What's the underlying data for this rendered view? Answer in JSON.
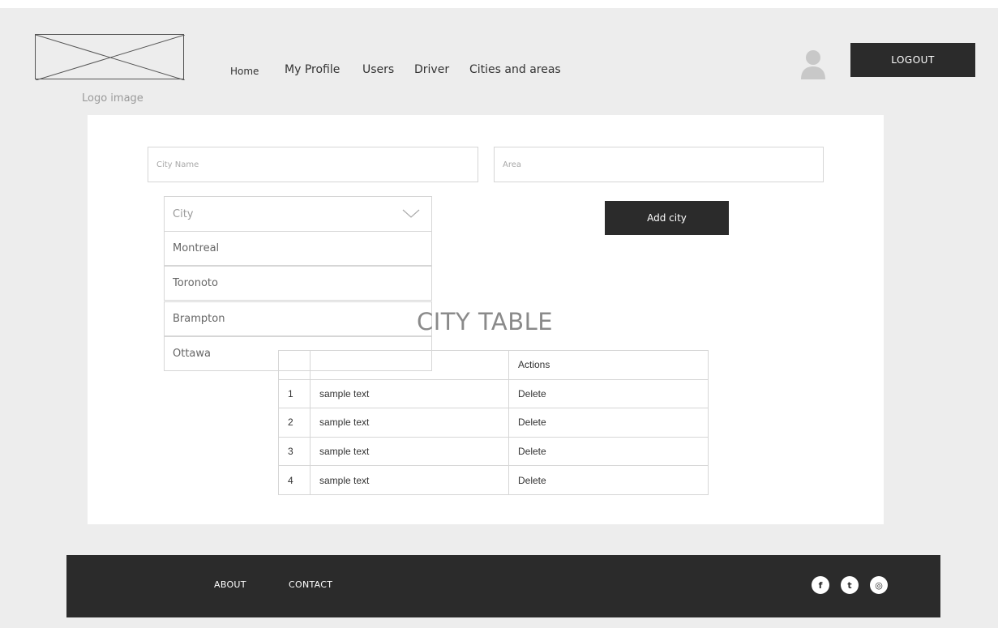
{
  "header": {
    "logo_caption": "Logo image",
    "nav": {
      "home": "Home",
      "my_profile": "My Profile",
      "users": "Users",
      "driver": "Driver",
      "cities_and_areas": "Cities and areas"
    },
    "logout_label": "LOGOUT"
  },
  "form": {
    "city_name_placeholder": "City Name",
    "area_placeholder": "Area",
    "city_dropdown": {
      "label": "City",
      "options": [
        "Montreal",
        "Toronoto",
        "Brampton",
        "Ottawa"
      ]
    },
    "add_city_label": "Add city"
  },
  "table": {
    "title": "CITY TABLE",
    "header": [
      "",
      "",
      "Actions"
    ],
    "rows": [
      {
        "index": "1",
        "text": "sample text",
        "action": "Delete"
      },
      {
        "index": "2",
        "text": "sample text",
        "action": "Delete"
      },
      {
        "index": "3",
        "text": "sample text",
        "action": "Delete"
      },
      {
        "index": "4",
        "text": "sample text",
        "action": "Delete"
      }
    ]
  },
  "footer": {
    "about": "ABOUT",
    "contact": "CONTACT",
    "social": [
      {
        "icon": "facebook-icon",
        "glyph": "f"
      },
      {
        "icon": "twitter-icon",
        "glyph": "t"
      },
      {
        "icon": "dribbble-icon",
        "glyph": "◎"
      }
    ]
  },
  "colors": {
    "page_bg": "#ededed",
    "panel_bg": "#ffffff",
    "dark": "#2b2b2b",
    "border": "#d6d6d6"
  }
}
